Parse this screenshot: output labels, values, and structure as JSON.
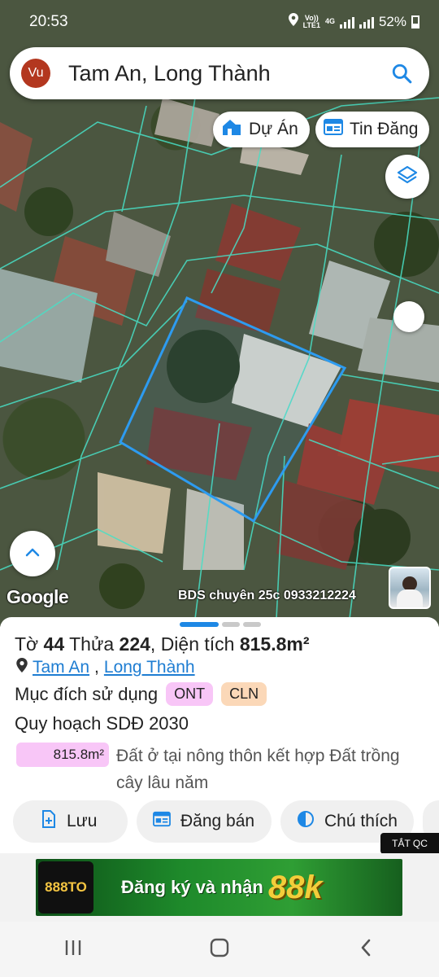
{
  "status_bar": {
    "time": "20:53",
    "network_top": "Vo))",
    "network_bottom": "LTE1",
    "network_type": "4G",
    "battery": "52%"
  },
  "search": {
    "avatar_initials": "Vu",
    "query": "Tam An, Long Thành"
  },
  "chips": {
    "projects": "Dự Án",
    "listings": "Tin Đăng"
  },
  "map": {
    "google_label": "Google",
    "watermark": "BDS chuyên 25c 0933212224"
  },
  "parcel": {
    "sheet_label": "Tờ",
    "sheet_no": "44",
    "lot_label": "Thửa",
    "lot_no": "224",
    "area_label": "Diện tích",
    "area_value": "815.8m²",
    "location_commune": "Tam An",
    "location_separator": ",",
    "location_district": "Long Thành",
    "purpose_label": "Mục đích sử dụng",
    "purpose_tags": [
      "ONT",
      "CLN"
    ],
    "plan_label": "Quy hoạch SDĐ 2030",
    "plan_area": "815.8m²",
    "plan_description": "Đất ở tại nông thôn kết hợp Đất trồng cây lâu năm"
  },
  "actions": {
    "save": "Lưu",
    "post": "Đăng bán",
    "legend": "Chú thích"
  },
  "ad": {
    "close_label": "TẮT QC",
    "logo_text": "888TO",
    "text": "Đăng ký và nhận",
    "amount": "88k"
  },
  "colors": {
    "accent": "#1e88e5",
    "parcel_line": "#48e0c6",
    "selected_parcel": "#2d9bf0",
    "ont_tag": "#f8c6f7",
    "cln_tag": "#fbd8b8"
  }
}
